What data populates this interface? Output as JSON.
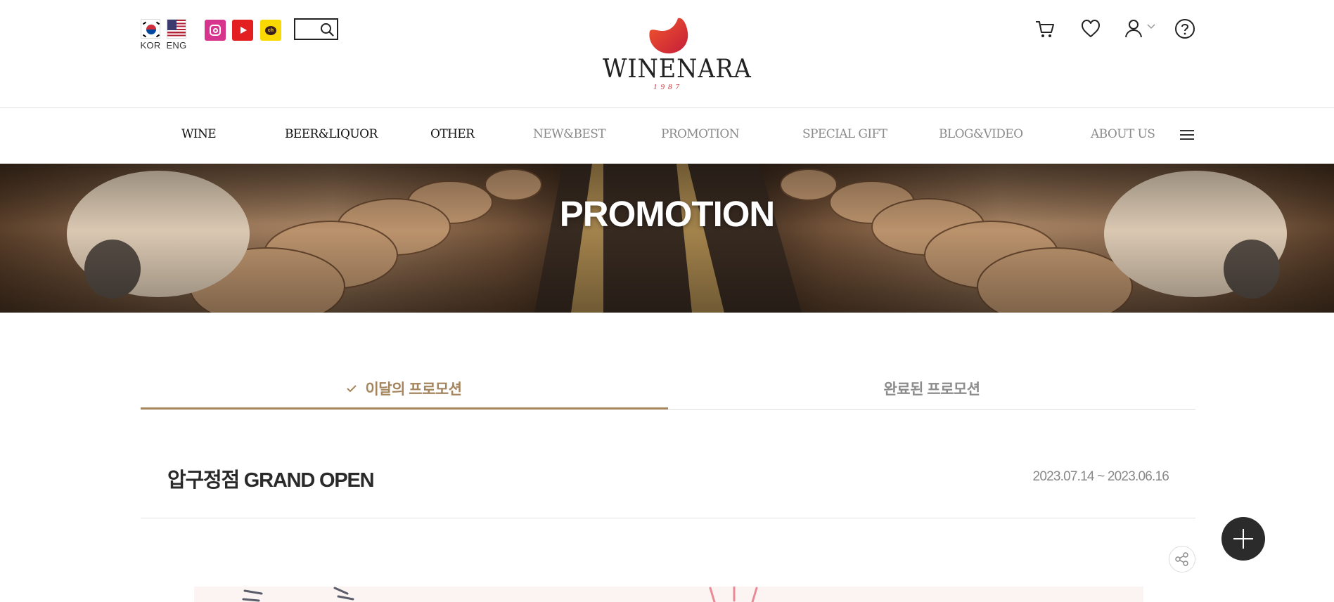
{
  "header": {
    "languages": [
      {
        "code": "KOR",
        "icon": "korea-flag-icon"
      },
      {
        "code": "ENG",
        "icon": "usa-flag-icon"
      }
    ],
    "social": [
      {
        "name": "instagram",
        "icon": "instagram-icon",
        "color": "#d6348d"
      },
      {
        "name": "youtube",
        "icon": "youtube-icon",
        "color": "#e41f1f"
      },
      {
        "name": "kakao-channel",
        "icon": "kakao-channel-icon",
        "color": "#f9d900"
      }
    ],
    "search": {
      "value": "",
      "icon": "search-icon"
    },
    "logo": {
      "wordmark": "WINENARA",
      "year": "1987",
      "brand_color": "#e0392f"
    },
    "utility_icons": [
      "cart-icon",
      "heart-icon",
      "user-icon",
      "help-icon"
    ]
  },
  "nav": {
    "items": [
      {
        "label": "WINE",
        "style": "dark"
      },
      {
        "label": "BEER&LIQUOR",
        "style": "dark"
      },
      {
        "label": "OTHER",
        "style": "dark"
      },
      {
        "label": "NEW&BEST",
        "style": "light"
      },
      {
        "label": "PROMOTION",
        "style": "light"
      },
      {
        "label": "SPECIAL GIFT",
        "style": "light"
      },
      {
        "label": "BLOG&VIDEO",
        "style": "light"
      },
      {
        "label": "ABOUT US",
        "style": "light"
      }
    ],
    "menu_icon": "hamburger-icon"
  },
  "hero": {
    "title": "PROMOTION"
  },
  "tabs": [
    {
      "label": "이달의 프로모션",
      "active": true,
      "icon": "check-icon"
    },
    {
      "label": "완료된 프로모션",
      "active": false
    }
  ],
  "promotion": {
    "title": "압구정점 GRAND OPEN",
    "period": "2023.07.14 ~ 2023.06.16"
  },
  "colors": {
    "accent": "#a5855e",
    "fab": "#2b2b2b",
    "text": "#333333"
  }
}
